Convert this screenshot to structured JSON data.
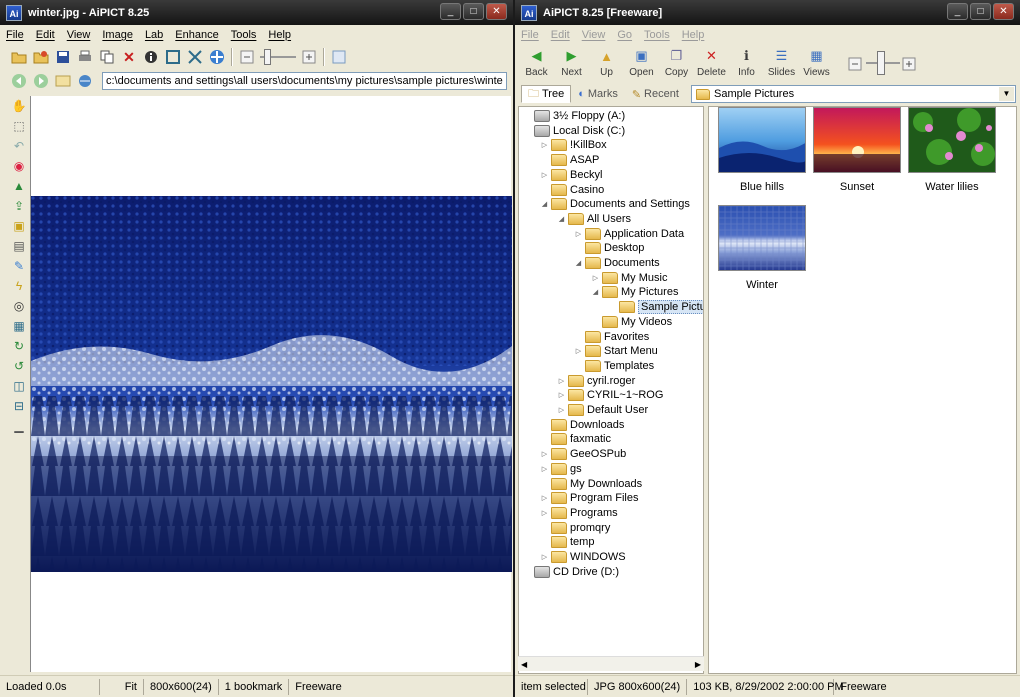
{
  "left": {
    "title": "winter.jpg - AiPICT 8.25",
    "app_icon": "Ai",
    "caption": {
      "minimize": "_",
      "maximize": "□",
      "close": "✕"
    },
    "menu": [
      "File",
      "Edit",
      "View",
      "Image",
      "Lab",
      "Enhance",
      "Tools",
      "Help"
    ],
    "toolbar_icons": [
      "folder-open-icon",
      "open-file-icon",
      "save-icon",
      "print-icon",
      "copy-icon",
      "delete-icon",
      "info-icon",
      "fit-icon",
      "zoom-icon",
      "move-icon",
      "zoom-out-icon",
      "zoom-slider-icon",
      "zoom-in-icon",
      "slideshow-icon"
    ],
    "address": {
      "value": "c:\\documents and settings\\all users\\documents\\my pictures\\sample pictures\\winter.jpg"
    },
    "tools": [
      "hand-icon",
      "select-icon",
      "undo-icon",
      "color-wheel-icon",
      "hill-icon",
      "upload-icon",
      "frame-icon",
      "gradient-icon",
      "wand-icon",
      "lightning-icon",
      "eye-icon",
      "film-icon",
      "rotate-right-icon",
      "rotate-left-icon",
      "flip-horizontal-icon",
      "flip-vertical-icon",
      "histogram-icon"
    ],
    "status": {
      "loaded": "Loaded 0.0s",
      "fit": "Fit",
      "dims": "800x600(24)",
      "bookmark": "1 bookmark",
      "license": "Freeware"
    }
  },
  "right": {
    "title": "AiPICT 8.25 [Freeware]",
    "app_icon": "Ai",
    "caption": {
      "minimize": "_",
      "maximize": "□",
      "close": "✕"
    },
    "menu": [
      "File",
      "Edit",
      "View",
      "Go",
      "Tools",
      "Help"
    ],
    "nav_buttons": [
      {
        "label": "Back",
        "icon": "back-icon",
        "glyph": "◀",
        "color": "#2f9e2f"
      },
      {
        "label": "Next",
        "icon": "next-icon",
        "glyph": "▶",
        "color": "#2f9e2f"
      },
      {
        "label": "Up",
        "icon": "up-folder-icon",
        "glyph": "▲",
        "color": "#d6a22a"
      },
      {
        "label": "Open",
        "icon": "open-icon",
        "glyph": "▣",
        "color": "#3b6fc0"
      },
      {
        "label": "Copy",
        "icon": "copy-icon",
        "glyph": "❐",
        "color": "#6a6a9a"
      },
      {
        "label": "Delete",
        "icon": "delete-icon",
        "glyph": "✕",
        "color": "#cc2020"
      },
      {
        "label": "Info",
        "icon": "info-icon",
        "glyph": "ℹ",
        "color": "#3a3a3a"
      },
      {
        "label": "Slides",
        "icon": "slides-icon",
        "glyph": "☰",
        "color": "#3b6fc0"
      },
      {
        "label": "Views",
        "icon": "views-icon",
        "glyph": "▦",
        "color": "#3b6fc0"
      }
    ],
    "tabs": [
      {
        "label": "Tree",
        "icon": "tree-icon",
        "glyph": "🗀"
      },
      {
        "label": "Marks",
        "icon": "marks-icon",
        "glyph": "◐"
      },
      {
        "label": "Recent",
        "icon": "recent-icon",
        "glyph": "✎"
      }
    ],
    "folder_select": {
      "value": "Sample Pictures"
    },
    "tree": [
      {
        "label": "3½ Floppy (A:)",
        "indent": 0,
        "exp": "",
        "type": "drive"
      },
      {
        "label": "Local Disk (C:)",
        "indent": 0,
        "exp": "",
        "type": "drive"
      },
      {
        "label": "!KillBox",
        "indent": 1,
        "exp": "▷",
        "type": "folder"
      },
      {
        "label": "ASAP",
        "indent": 1,
        "exp": "",
        "type": "folder"
      },
      {
        "label": "Beckyl",
        "indent": 1,
        "exp": "▷",
        "type": "folder"
      },
      {
        "label": "Casino",
        "indent": 1,
        "exp": "",
        "type": "folder"
      },
      {
        "label": "Documents and Settings",
        "indent": 1,
        "exp": "◢",
        "type": "folder"
      },
      {
        "label": "All Users",
        "indent": 2,
        "exp": "◢",
        "type": "folder"
      },
      {
        "label": "Application Data",
        "indent": 3,
        "exp": "▷",
        "type": "folder"
      },
      {
        "label": "Desktop",
        "indent": 3,
        "exp": "",
        "type": "folder"
      },
      {
        "label": "Documents",
        "indent": 3,
        "exp": "◢",
        "type": "folder"
      },
      {
        "label": "My Music",
        "indent": 4,
        "exp": "▷",
        "type": "folder"
      },
      {
        "label": "My Pictures",
        "indent": 4,
        "exp": "◢",
        "type": "folder"
      },
      {
        "label": "Sample Pictures",
        "indent": 5,
        "exp": "",
        "type": "folder",
        "selected": true
      },
      {
        "label": "My Videos",
        "indent": 4,
        "exp": "",
        "type": "folder"
      },
      {
        "label": "Favorites",
        "indent": 3,
        "exp": "",
        "type": "folder"
      },
      {
        "label": "Start Menu",
        "indent": 3,
        "exp": "▷",
        "type": "folder"
      },
      {
        "label": "Templates",
        "indent": 3,
        "exp": "",
        "type": "folder"
      },
      {
        "label": "cyril.roger",
        "indent": 2,
        "exp": "▷",
        "type": "folder"
      },
      {
        "label": "CYRIL~1~ROG",
        "indent": 2,
        "exp": "▷",
        "type": "folder"
      },
      {
        "label": "Default User",
        "indent": 2,
        "exp": "▷",
        "type": "folder"
      },
      {
        "label": "Downloads",
        "indent": 1,
        "exp": "",
        "type": "folder"
      },
      {
        "label": "faxmatic",
        "indent": 1,
        "exp": "",
        "type": "folder"
      },
      {
        "label": "GeeOSPub",
        "indent": 1,
        "exp": "▷",
        "type": "folder"
      },
      {
        "label": "gs",
        "indent": 1,
        "exp": "▷",
        "type": "folder"
      },
      {
        "label": "My Downloads",
        "indent": 1,
        "exp": "",
        "type": "folder"
      },
      {
        "label": "Program Files",
        "indent": 1,
        "exp": "▷",
        "type": "folder"
      },
      {
        "label": "Programs",
        "indent": 1,
        "exp": "▷",
        "type": "folder"
      },
      {
        "label": "promqry",
        "indent": 1,
        "exp": "",
        "type": "folder"
      },
      {
        "label": "temp",
        "indent": 1,
        "exp": "",
        "type": "folder"
      },
      {
        "label": "WINDOWS",
        "indent": 1,
        "exp": "▷",
        "type": "folder"
      },
      {
        "label": "CD Drive (D:)",
        "indent": 0,
        "exp": "",
        "type": "drive"
      }
    ],
    "thumbnails": [
      {
        "label": "Blue hills",
        "kind": "blue-hills"
      },
      {
        "label": "Sunset",
        "kind": "sunset"
      },
      {
        "label": "Water lilies",
        "kind": "water-lilies"
      },
      {
        "label": "Winter",
        "kind": "winter"
      }
    ],
    "status": {
      "selected": "item selected",
      "format": "JPG 800x600(24)",
      "info": "103 KB, 8/29/2002 2:00:00 PM",
      "license": "Freeware"
    }
  }
}
